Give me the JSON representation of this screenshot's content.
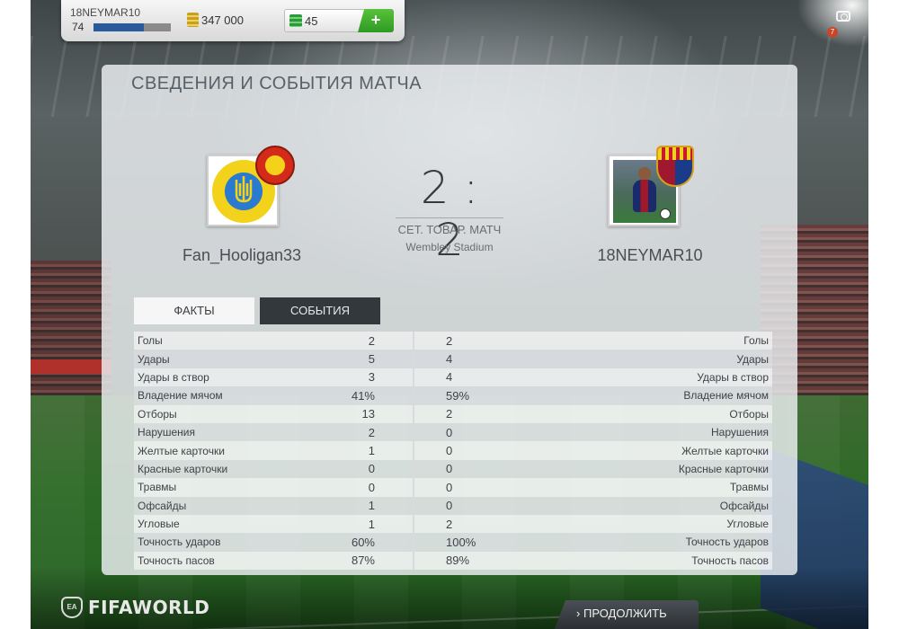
{
  "profile": {
    "username": "18NEYMAR10",
    "level": "74",
    "xp_fraction": 0.65,
    "coins": "347 000",
    "points": "45",
    "add_label": "+"
  },
  "notification_count": "7",
  "panel": {
    "title": "СВЕДЕНИЯ И СОБЫТИЯ МАТЧА"
  },
  "match": {
    "score": "2 : 2",
    "type": "СЕТ. ТОВАР. МАТЧ",
    "stadium": "Wembley Stadium",
    "home_team": "Fan_Hooligan33",
    "away_team": "18NEYMAR10"
  },
  "tabs": {
    "facts": "ФАКТЫ",
    "events": "СОБЫТИЯ"
  },
  "stats": [
    {
      "label": "Голы",
      "home": "2",
      "away": "2"
    },
    {
      "label": "Удары",
      "home": "5",
      "away": "4"
    },
    {
      "label": "Удары в створ",
      "home": "3",
      "away": "4"
    },
    {
      "label": "Владение мячом",
      "home": "41%",
      "away": "59%"
    },
    {
      "label": "Отборы",
      "home": "13",
      "away": "2"
    },
    {
      "label": "Нарушения",
      "home": "2",
      "away": "0"
    },
    {
      "label": "Желтые карточки",
      "home": "1",
      "away": "0"
    },
    {
      "label": "Красные карточки",
      "home": "0",
      "away": "0"
    },
    {
      "label": "Травмы",
      "home": "0",
      "away": "0"
    },
    {
      "label": "Офсайды",
      "home": "1",
      "away": "0"
    },
    {
      "label": "Угловые",
      "home": "1",
      "away": "2"
    },
    {
      "label": "Точность ударов",
      "home": "60%",
      "away": "100%"
    },
    {
      "label": "Точность пасов",
      "home": "87%",
      "away": "89%"
    }
  ],
  "footer": {
    "brand": "FIFAWORLD",
    "ea_label": "EA",
    "continue": "ПРОДОЛЖИТЬ",
    "continue_icon": "chevron-right-icon"
  },
  "colors": {
    "accent_green": "#2f9a22",
    "tab_active_bg": "#33383d",
    "xp_fill": "#2a5a9a"
  }
}
